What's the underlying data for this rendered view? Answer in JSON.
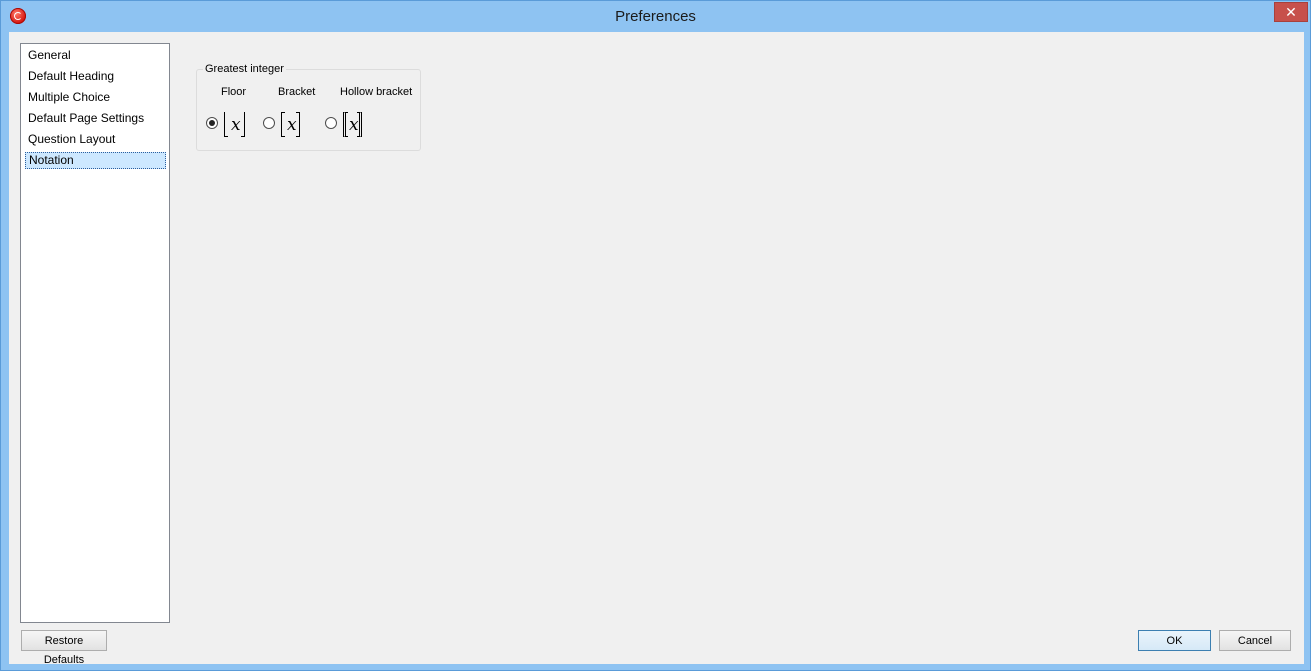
{
  "window": {
    "title": "Preferences",
    "close_label": "✕",
    "app_icon": "app-logo-icon"
  },
  "sidebar": {
    "items": [
      {
        "label": "General"
      },
      {
        "label": "Default Heading"
      },
      {
        "label": "Multiple Choice"
      },
      {
        "label": "Default Page Settings"
      },
      {
        "label": "Question Layout"
      },
      {
        "label": "Notation",
        "selected": true
      }
    ]
  },
  "notation": {
    "group_title": "Greatest integer",
    "options": [
      {
        "label": "Floor",
        "symbol": "x",
        "checked": true
      },
      {
        "label": "Bracket",
        "symbol": "x",
        "checked": false
      },
      {
        "label": "Hollow bracket",
        "symbol": "x",
        "checked": false
      }
    ]
  },
  "footer": {
    "restore_label": "Restore Defaults",
    "ok_label": "OK",
    "cancel_label": "Cancel"
  },
  "colors": {
    "titlebar": "#8ec3f2",
    "close": "#c7504b",
    "selection": "#cde8ff"
  }
}
